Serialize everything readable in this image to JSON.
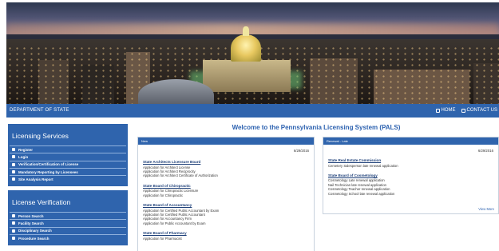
{
  "topbar": {
    "department": "DEPARTMENT OF STATE",
    "links": [
      {
        "label": "HOME",
        "icon": "home-icon"
      },
      {
        "label": "CONTACT US",
        "icon": "contact-icon"
      }
    ]
  },
  "sidebar": {
    "licensing": {
      "title": "Licensing Services",
      "items": [
        {
          "label": "Register",
          "icon": "user-plus-icon"
        },
        {
          "label": "Login",
          "icon": "login-icon"
        },
        {
          "label": "Verification/Certification of License",
          "icon": "certificate-icon"
        },
        {
          "label": "Mandatory Reporting by Licensees",
          "icon": "reporting-icon"
        },
        {
          "label": "Site Analysis Report",
          "icon": "report-icon"
        }
      ]
    },
    "verification": {
      "title": "License Verification",
      "items": [
        {
          "label": "Person Search",
          "icon": "person-icon"
        },
        {
          "label": "Facility Search",
          "icon": "building-icon"
        },
        {
          "label": "Disciplinary Search",
          "icon": "gavel-icon"
        },
        {
          "label": "Procedure Search",
          "icon": "document-icon"
        }
      ]
    }
  },
  "main": {
    "welcome": "Welcome to the Pennsylvania Licensing System (PALS)",
    "new_box": {
      "header": "New",
      "date": "6/29/2016",
      "sections": [
        {
          "title": "State Architects Licensure Board",
          "lines": [
            "Application for Architect License",
            "Application for Architect Reciprocity",
            "Application for Architect Certificate of Authorization"
          ]
        },
        {
          "title": "State Board of Chiropractic",
          "lines": [
            "Application for Chiropractic Licensure",
            "Application for Chiropractic"
          ]
        },
        {
          "title": "State Board of Accountancy",
          "lines": [
            "Application for Certified Public Accountant by Exam",
            "Application for Certified Public Accountant",
            "Application for Accountancy Firm",
            "Application for Public Accountant by Exam"
          ]
        },
        {
          "title": "State Board of Pharmacy",
          "lines": [
            "Application for Pharmacist"
          ]
        }
      ]
    },
    "renew_box": {
      "header": "Renewal - Late",
      "date": "6/29/2016",
      "sections": [
        {
          "title": "State Real Estate Commission",
          "lines": [
            "Cemetery Salesperson late renewal application"
          ]
        },
        {
          "title": "State Board of Cosmetology",
          "lines": [
            "Cosmetology Late renewal application",
            "Nail Technician late renewal application",
            "Cosmetology Teacher renewal application",
            "Cosmetology School late renewal application"
          ]
        }
      ],
      "view_more": "View More"
    }
  },
  "colors": {
    "brand_blue": "#2f64ad",
    "title_blue": "#2d62b0",
    "link_dark": "#1d3f78"
  }
}
